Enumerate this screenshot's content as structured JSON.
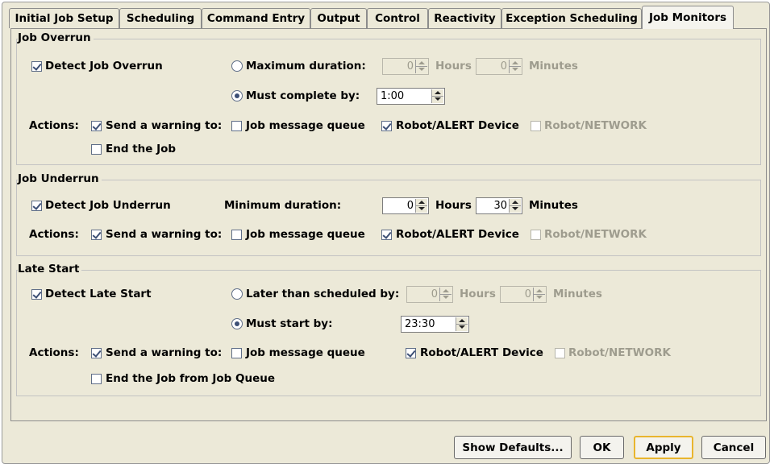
{
  "tabs": [
    {
      "label": "Initial Job Setup"
    },
    {
      "label": "Scheduling"
    },
    {
      "label": "Command Entry"
    },
    {
      "label": "Output"
    },
    {
      "label": "Control"
    },
    {
      "label": "Reactivity"
    },
    {
      "label": "Exception Scheduling"
    },
    {
      "label": "Job Monitors",
      "selected": true
    }
  ],
  "overrun": {
    "title": "Job Overrun",
    "detect_label": "Detect Job Overrun",
    "detect_checked": true,
    "max_duration_label": "Maximum duration:",
    "max_duration_selected": false,
    "max_hours_value": "0",
    "hours_label": "Hours",
    "max_minutes_value": "0",
    "minutes_label": "Minutes",
    "must_complete_label": "Must complete by:",
    "must_complete_selected": true,
    "must_complete_value": "1:00",
    "actions_label": "Actions:",
    "send_warning_label": "Send a warning to:",
    "send_warning_checked": true,
    "job_message_queue_label": "Job message queue",
    "job_message_queue_checked": false,
    "robot_alert_label": "Robot/ALERT Device",
    "robot_alert_checked": true,
    "robot_network_label": "Robot/NETWORK",
    "robot_network_checked": false,
    "end_job_label": "End the Job",
    "end_job_checked": false
  },
  "underrun": {
    "title": "Job Underrun",
    "detect_label": "Detect Job Underrun",
    "detect_checked": true,
    "min_duration_label": "Minimum duration:",
    "hours_value": "0",
    "hours_label": "Hours",
    "minutes_value": "30",
    "minutes_label": "Minutes",
    "actions_label": "Actions:",
    "send_warning_label": "Send a warning to:",
    "send_warning_checked": true,
    "job_message_queue_label": "Job message queue",
    "job_message_queue_checked": false,
    "robot_alert_label": "Robot/ALERT Device",
    "robot_alert_checked": true,
    "robot_network_label": "Robot/NETWORK",
    "robot_network_checked": false
  },
  "late_start": {
    "title": "Late Start",
    "detect_label": "Detect Late Start",
    "detect_checked": true,
    "later_than_label": "Later than scheduled by:",
    "later_than_selected": false,
    "hours_value": "0",
    "hours_label": "Hours",
    "minutes_value": "0",
    "minutes_label": "Minutes",
    "must_start_label": "Must start by:",
    "must_start_selected": true,
    "must_start_value": "23:30",
    "actions_label": "Actions:",
    "send_warning_label": "Send a warning to:",
    "send_warning_checked": true,
    "job_message_queue_label": "Job message queue",
    "job_message_queue_checked": false,
    "robot_alert_label": "Robot/ALERT Device",
    "robot_alert_checked": true,
    "robot_network_label": "Robot/NETWORK",
    "robot_network_checked": false,
    "end_job_label": "End the Job from Job Queue",
    "end_job_checked": false
  },
  "buttons": {
    "show_defaults": "Show Defaults...",
    "ok": "OK",
    "apply": "Apply",
    "cancel": "Cancel"
  },
  "colors": {
    "window_bg": "#ece9d8",
    "disabled_text": "#9e9c8e",
    "focus_border": "#e9b52d"
  }
}
